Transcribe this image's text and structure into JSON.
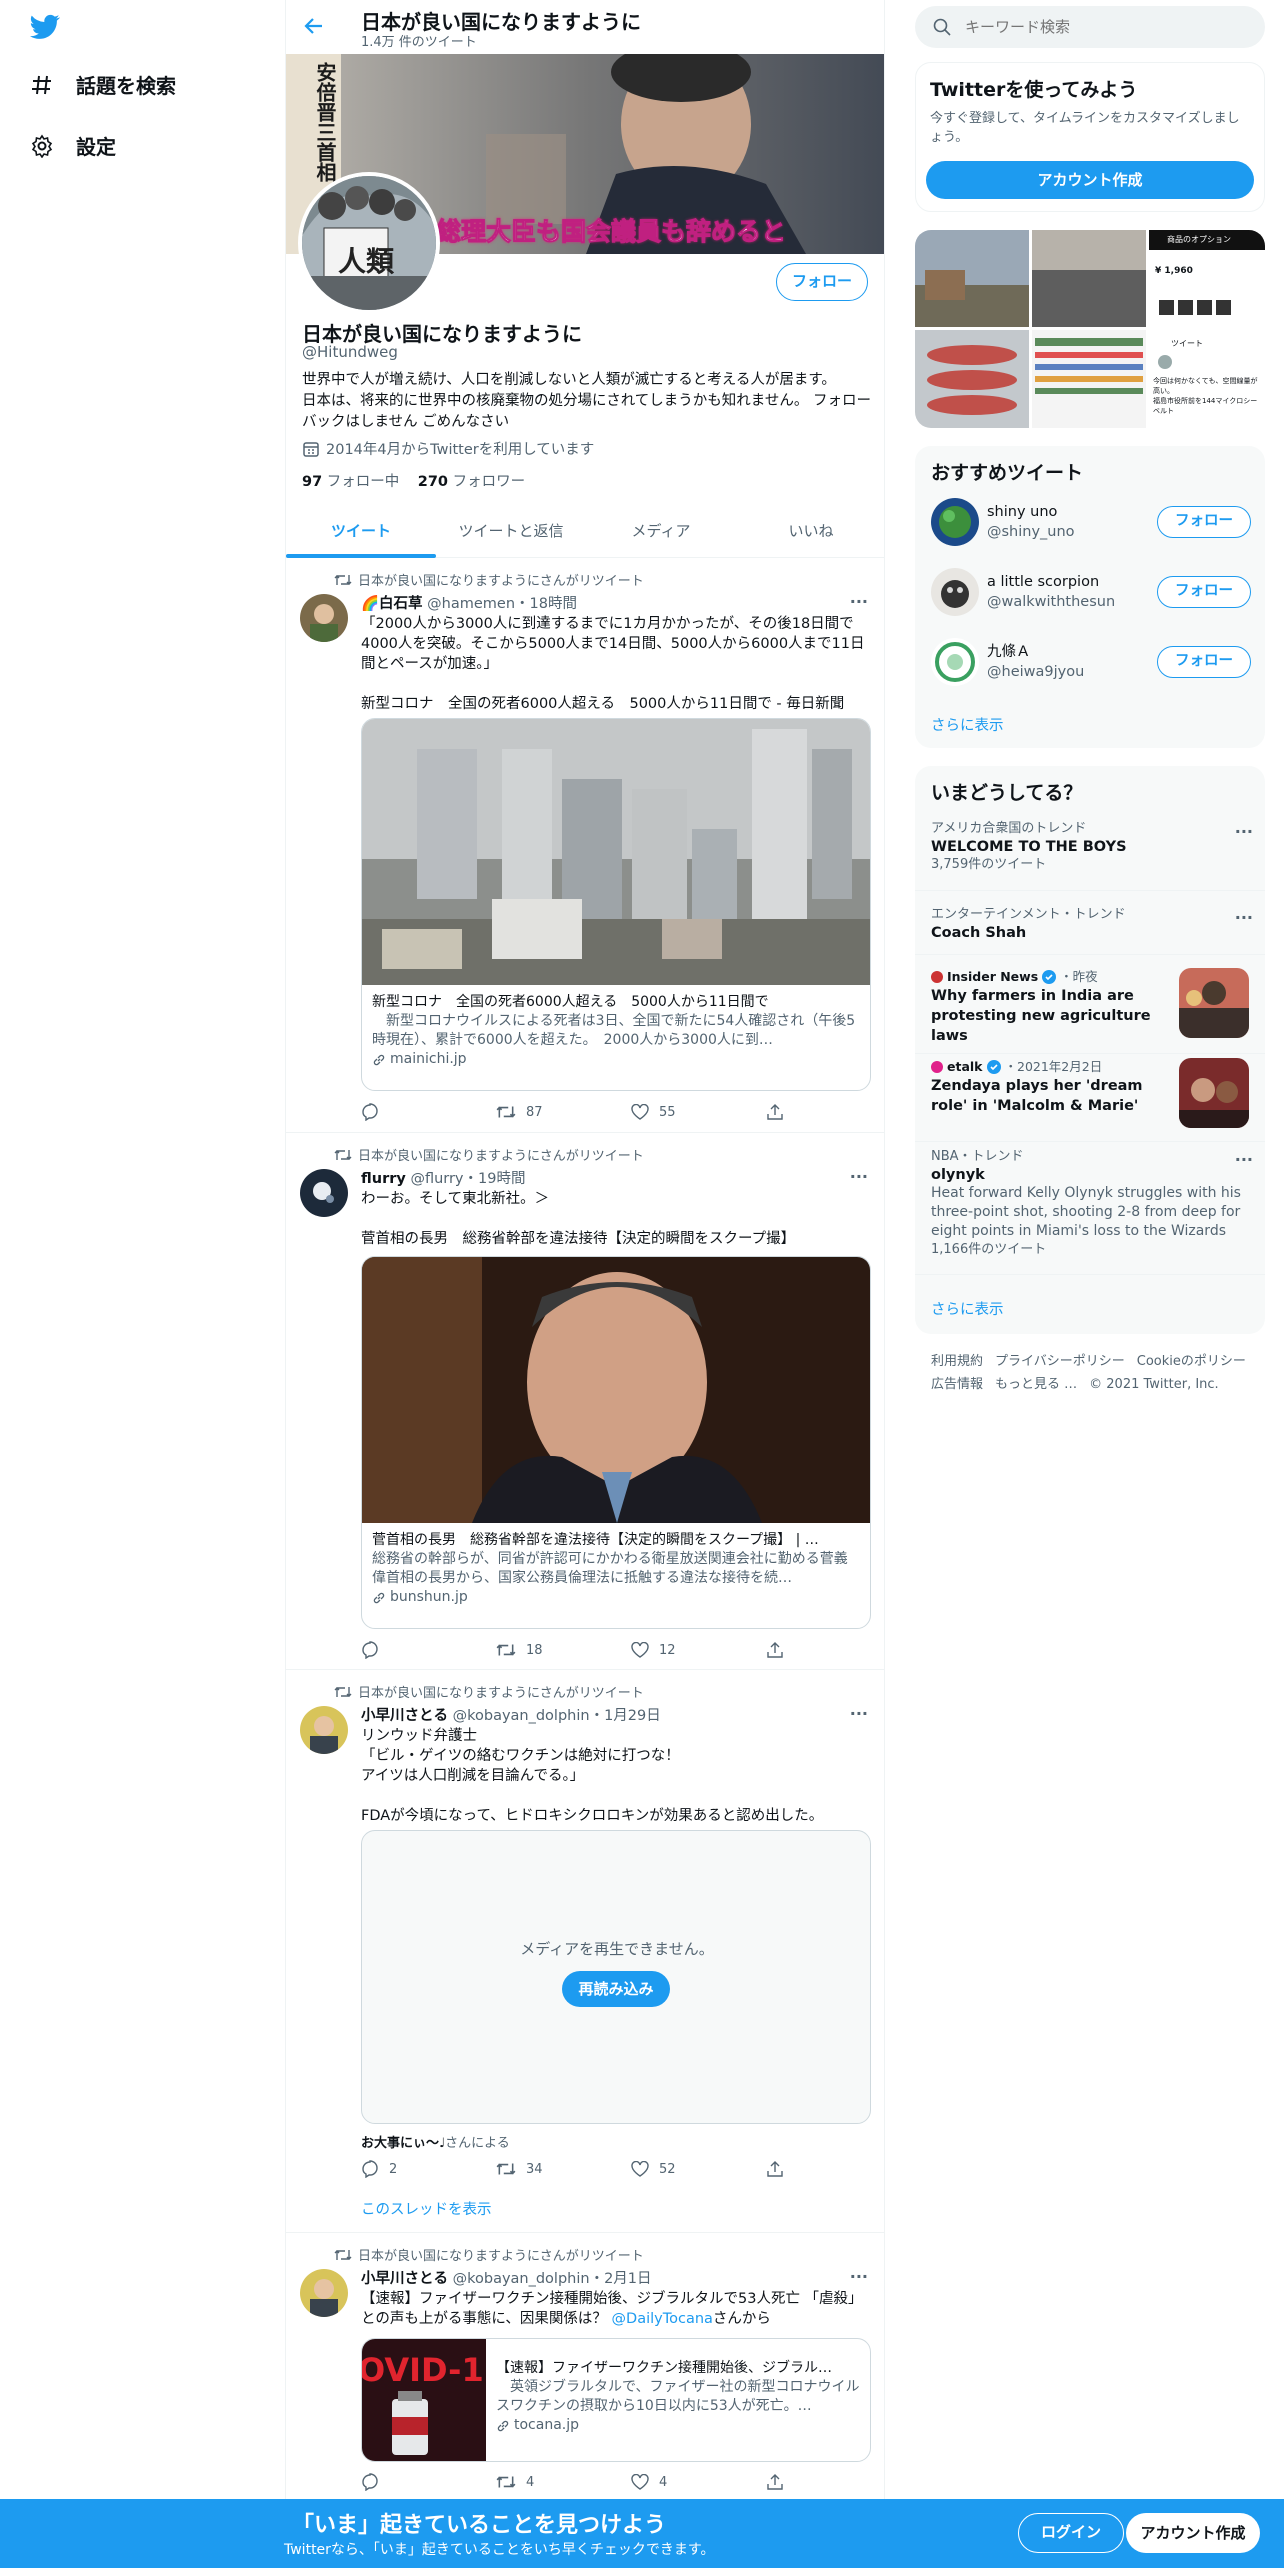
{
  "nav": {
    "explore_label": "話題を検索",
    "settings_label": "設定"
  },
  "header": {
    "title": "日本が良い国になりますように",
    "tweet_count": "1.4万 件のツイート"
  },
  "profile": {
    "banner_text_vertical": "安倍晋三首相",
    "banner_caption": "総理大臣も国会議員も辞めると",
    "avatar_sign_text": "人類",
    "follow_label": "フォロー",
    "name": "日本が良い国になりますように",
    "handle": "@Hitundweg",
    "bio": "世界中で人が増え続け、人口を削減しないと人類が滅亡すると考える人が居ます。\n日本は、将来的に世界中の核廃棄物の処分場にされてしまうかも知れません。 フォローバックはしません ごめんなさい",
    "joined": "2014年4月からTwitterを利用しています",
    "following_count": "97",
    "following_label": "フォロー中",
    "followers_count": "270",
    "followers_label": "フォロワー"
  },
  "tabs": [
    "ツイート",
    "ツイートと返信",
    "メディア",
    "いいね"
  ],
  "tweets": [
    {
      "retweet_label": "日本が良い国になりますようにさんがリツイート",
      "name": "🌈白石草",
      "handle": "@hamemen",
      "time": "18時間",
      "text": "「2000人から3000人に到達するまでに1カ月かかったが、その後18日間で4000人を突破。そこから5000人まで14日間、5000人から6000人まで11日間とペースが加速。」\n\n新型コロナ　全国の死者6000人超える　5000人から11日間で - 毎日新聞",
      "card_title": "新型コロナ　全国の死者6000人超える　5000人から11日間で",
      "card_desc": "　新型コロナウイルスによる死者は3日、全国で新たに54人確認され（午後5時現在）、累計で6000人を超えた。　2000人から3000人に到…",
      "card_domain": "mainichi.jp",
      "replies": "",
      "retweets": "87",
      "likes": "55"
    },
    {
      "retweet_label": "日本が良い国になりますようにさんがリツイート",
      "name": "flurry",
      "handle": "@flurry",
      "time": "19時間",
      "text": "わーお。そして東北新社。＞\n\n菅首相の長男　総務省幹部を違法接待【決定的瞬間をスクープ撮】",
      "card_title": "菅首相の長男　総務省幹部を違法接待【決定的瞬間をスクープ撮】 | …",
      "card_desc": "総務省の幹部らが、同省が許認可にかかわる衛星放送関連会社に勤める菅義偉首相の長男から、国家公務員倫理法に抵触する違法な接待を続…",
      "card_domain": "bunshun.jp",
      "replies": "",
      "retweets": "18",
      "likes": "12"
    },
    {
      "retweet_label": "日本が良い国になりますようにさんがリツイート",
      "name": "小早川さとる",
      "handle": "@kobayan_dolphin",
      "time": "1月29日",
      "text": "リンウッド弁護士\n「ビル・ゲイツの絡むワクチンは絶対に打つな！\nアイツは人口削減を目論んでる。」\n\nFDAが今頃になって、ヒドロキシクロロキンが効果あると認め出した。",
      "media_error": "メディアを再生できません。",
      "reload_label": "再読み込み",
      "attribution_name": "お大事にぃ〜♩",
      "attribution_suffix": "さんによる",
      "replies": "2",
      "retweets": "34",
      "likes": "52",
      "thread_link": "このスレッドを表示"
    },
    {
      "retweet_label": "日本が良い国になりますようにさんがリツイート",
      "name": "小早川さとる",
      "handle": "@kobayan_dolphin",
      "time": "2月1日",
      "text_before": "【速報】ファイザーワクチン接種開始後、ジブラルタルで53人死亡 「虐殺」との声も上がる事態に、因果関係は？ ",
      "text_mention": "@DailyTocana",
      "text_after": "さんから",
      "card_title": "【速報】ファイザーワクチン接種開始後、ジブラル…",
      "card_desc": "　英領ジブラルタルで、ファイザー社の新型コロナウイルスワクチンの摂取から10日以内に53人が死亡。…",
      "card_domain": "tocana.jp",
      "card_thumb_text": "OVID-1",
      "replies": "",
      "retweets": "4",
      "likes": "4"
    }
  ],
  "sidebar": {
    "search_placeholder": "キーワード検索",
    "signup": {
      "title": "Twitterを使ってみよう",
      "desc": "今すぐ登録して、タイムラインをカスタマイズしましょう。",
      "button": "アカウント作成"
    },
    "media_thumb_text": {
      "header": "商品のオプション",
      "price": "¥ 1,960",
      "tweet_title": "ツイート",
      "tweet_text": "今回は何かなくても、空間線量が高い。\n福島市役所前を144マイクロシーベルト"
    },
    "who_to_follow": {
      "title": "おすすめツイート",
      "users": [
        {
          "name": "shiny uno",
          "handle": "@shiny_uno",
          "button": "フォロー"
        },
        {
          "name": "a little scorpion",
          "handle": "@walkwiththesun",
          "button": "フォロー"
        },
        {
          "name": "九條Ａ",
          "handle": "@heiwa9jyou",
          "button": "フォロー"
        }
      ],
      "more": "さらに表示"
    },
    "trends": {
      "title": "いまどうしてる？",
      "items": [
        {
          "context": "アメリカ合衆国のトレンド",
          "title": "WELCOME TO THE BOYS",
          "count": "3,759件のツイート"
        },
        {
          "context": "エンターテインメント・トレンド",
          "title": "Coach Shah"
        },
        {
          "source": "Insider News",
          "time": "・昨夜",
          "title": "Why farmers in India are protesting new agriculture laws"
        },
        {
          "source": "etalk",
          "time": "・2021年2月2日",
          "title": "Zendaya plays her 'dream role' in 'Malcolm & Marie'"
        },
        {
          "context": "NBA・トレンド",
          "title": "olynyk",
          "desc": "Heat forward Kelly Olynyk struggles with his three-point shot, shooting 2-8 from deep for eight points in Miami's loss to the Wizards",
          "count": "1,166件のツイート"
        }
      ],
      "more": "さらに表示"
    },
    "footer": [
      "利用規約",
      "プライバシーポリシー",
      "Cookieのポリシー",
      "広告情報",
      "もっと見る …",
      "© 2021 Twitter, Inc."
    ]
  },
  "bottom_bar": {
    "title": "「いま」起きていることを見つけよう",
    "subtitle": "Twitterなら、「いま」起きていることをいち早くチェックできます。",
    "login": "ログイン",
    "signup": "アカウント作成"
  },
  "colors": {
    "accent": "#1d9bf0",
    "text": "#0f1419",
    "muted": "#536471",
    "panel": "#f7f9f9"
  }
}
